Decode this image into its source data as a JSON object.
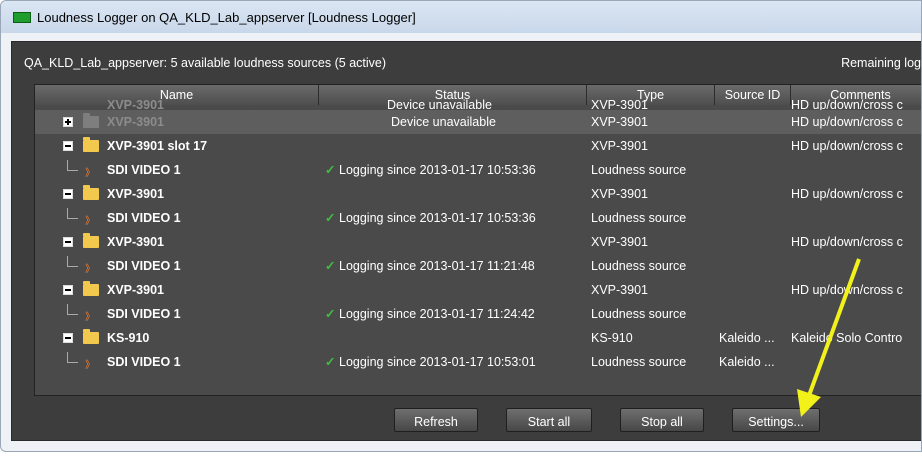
{
  "window": {
    "title": "Loudness Logger on QA_KLD_Lab_appserver [Loudness Logger]"
  },
  "summary": {
    "status": "QA_KLD_Lab_appserver: 5 available loudness sources (5 active)",
    "remaining": "Remaining log"
  },
  "columns": [
    "Name",
    "Status",
    "Type",
    "Source ID",
    "Comments"
  ],
  "rows": [
    {
      "name": "XVP-3901",
      "status": "Device unavailable",
      "type": "XVP-3901",
      "source_id": "",
      "comments": "HD up/down/cross c"
    },
    {
      "name": "XVP-3901",
      "status": "Device unavailable",
      "type": "XVP-3901",
      "source_id": "",
      "comments": "HD up/down/cross c"
    },
    {
      "name": "XVP-3901 slot 17",
      "status": "",
      "type": "XVP-3901",
      "source_id": "",
      "comments": "HD up/down/cross c"
    },
    {
      "name": "SDI VIDEO 1",
      "status": "Logging since 2013-01-17 10:53:36",
      "type": "Loudness source",
      "source_id": "",
      "comments": ""
    },
    {
      "name": "XVP-3901",
      "status": "",
      "type": "XVP-3901",
      "source_id": "",
      "comments": "HD up/down/cross c"
    },
    {
      "name": "SDI VIDEO 1",
      "status": "Logging since 2013-01-17 10:53:36",
      "type": "Loudness source",
      "source_id": "",
      "comments": ""
    },
    {
      "name": "XVP-3901",
      "status": "",
      "type": "XVP-3901",
      "source_id": "",
      "comments": "HD up/down/cross c"
    },
    {
      "name": "SDI VIDEO 1",
      "status": "Logging since 2013-01-17 11:21:48",
      "type": "Loudness source",
      "source_id": "",
      "comments": ""
    },
    {
      "name": "XVP-3901",
      "status": "",
      "type": "XVP-3901",
      "source_id": "",
      "comments": "HD up/down/cross c"
    },
    {
      "name": "SDI VIDEO 1",
      "status": "Logging since 2013-01-17 11:24:42",
      "type": "Loudness source",
      "source_id": "",
      "comments": ""
    },
    {
      "name": "KS-910",
      "status": "",
      "type": "KS-910",
      "source_id": "Kaleido ...",
      "comments": "Kaleido Solo Contro"
    },
    {
      "name": "SDI VIDEO 1",
      "status": "Logging since 2013-01-17 10:53:01",
      "type": "Loudness source",
      "source_id": "Kaleido ...",
      "comments": ""
    }
  ],
  "buttons": {
    "refresh": "Refresh",
    "start_all": "Start all",
    "stop_all": "Stop all",
    "settings": "Settings..."
  },
  "icons": {
    "check": "✓",
    "rss": "》"
  },
  "colors": {
    "accent_arrow": "#f2f21a",
    "check": "#3fbf3f",
    "folder": "#f2c94c"
  }
}
